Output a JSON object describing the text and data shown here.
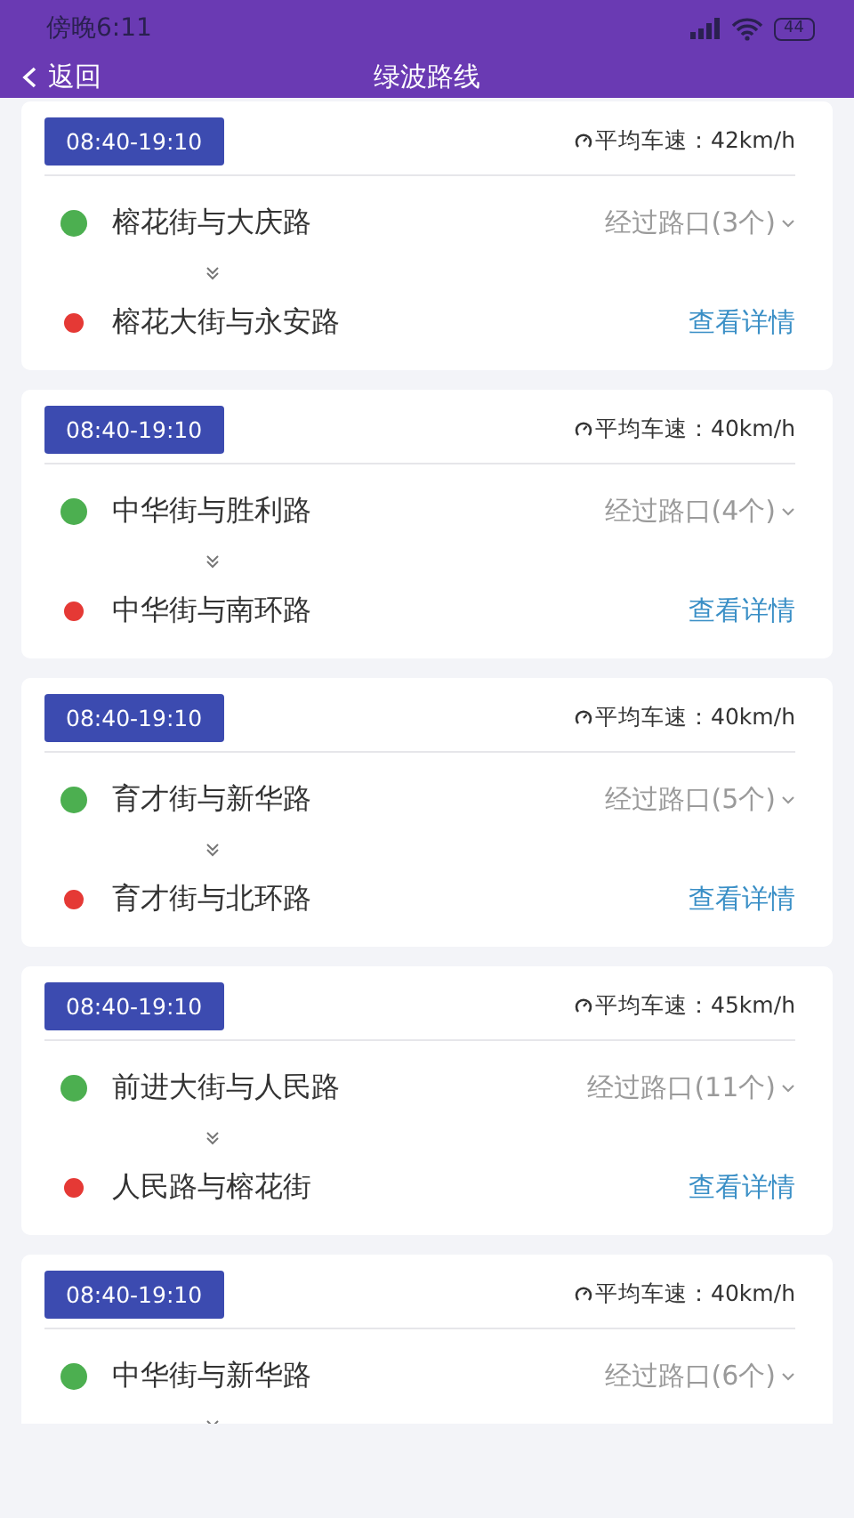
{
  "status_bar": {
    "time": "傍晚6:11",
    "battery": "44"
  },
  "nav": {
    "back": "返回",
    "title": "绿波路线"
  },
  "routes": [
    {
      "time": "08:40-19:10",
      "speed": "平均车速：42km/h",
      "start": "榕花街与大庆路",
      "passes": "经过路口(3个)",
      "end": "榕花大街与永安路",
      "details": "查看详情"
    },
    {
      "time": "08:40-19:10",
      "speed": "平均车速：40km/h",
      "start": "中华街与胜利路",
      "passes": "经过路口(4个)",
      "end": "中华街与南环路",
      "details": "查看详情"
    },
    {
      "time": "08:40-19:10",
      "speed": "平均车速：40km/h",
      "start": "育才街与新华路",
      "passes": "经过路口(5个)",
      "end": "育才街与北环路",
      "details": "查看详情"
    },
    {
      "time": "08:40-19:10",
      "speed": "平均车速：45km/h",
      "start": "前进大街与人民路",
      "passes": "经过路口(11个)",
      "end": "人民路与榕花街",
      "details": "查看详情"
    },
    {
      "time": "08:40-19:10",
      "speed": "平均车速：40km/h",
      "start": "中华街与新华路",
      "passes": "经过路口(6个)"
    }
  ]
}
